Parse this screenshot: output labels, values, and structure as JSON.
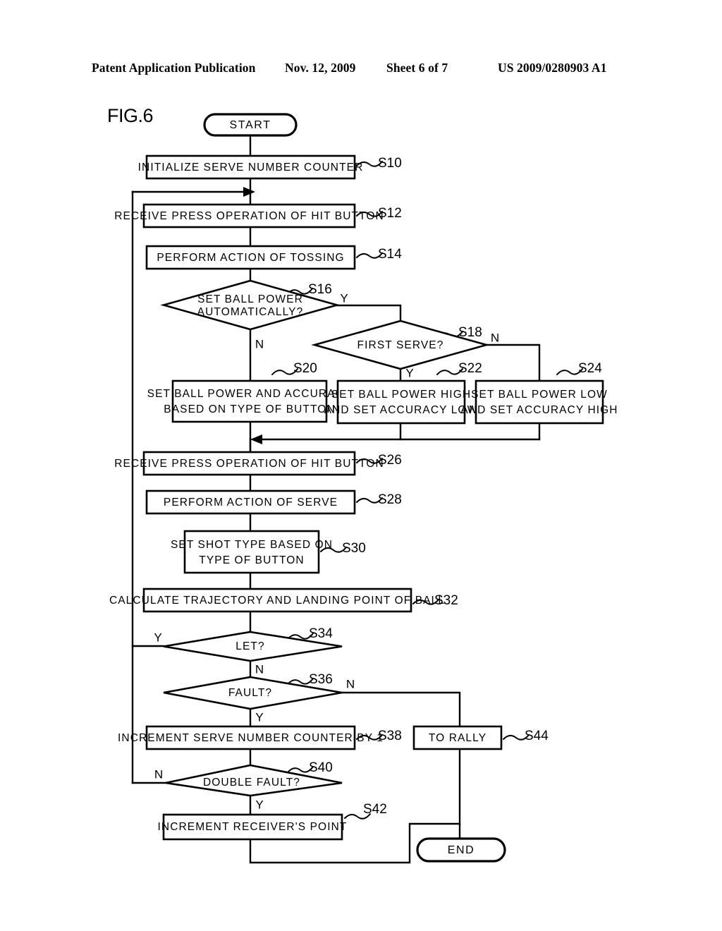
{
  "header": {
    "publication": "Patent Application Publication",
    "date": "Nov. 12, 2009",
    "sheet": "Sheet 6 of 7",
    "number": "US 2009/0280903 A1"
  },
  "figure": {
    "label": "FIG.6"
  },
  "chart_data": {
    "type": "diagram",
    "title": "FIG.6",
    "diagram_kind": "flowchart",
    "terminals": [
      {
        "id": "start",
        "label": "START"
      },
      {
        "id": "end",
        "label": "END"
      }
    ],
    "nodes": [
      {
        "step": "S10",
        "shape": "process",
        "text": "INITIALIZE SERVE NUMBER COUNTER"
      },
      {
        "step": "S12",
        "shape": "process",
        "text": "RECEIVE PRESS OPERATION OF HIT BUTTON"
      },
      {
        "step": "S14",
        "shape": "process",
        "text": "PERFORM ACTION OF TOSSING"
      },
      {
        "step": "S16",
        "shape": "decision",
        "text": "SET BALL POWER AUTOMATICALLY?"
      },
      {
        "step": "S18",
        "shape": "decision",
        "text": "FIRST SERVE?"
      },
      {
        "step": "S20",
        "shape": "process",
        "text": "SET BALL POWER AND ACCURACY BASED ON TYPE OF BUTTON"
      },
      {
        "step": "S22",
        "shape": "process",
        "text": "SET BALL POWER HIGH AND SET ACCURACY LOW"
      },
      {
        "step": "S24",
        "shape": "process",
        "text": "SET BALL POWER LOW AND SET ACCURACY HIGH"
      },
      {
        "step": "S26",
        "shape": "process",
        "text": "RECEIVE PRESS OPERATION OF HIT BUTTON"
      },
      {
        "step": "S28",
        "shape": "process",
        "text": "PERFORM ACTION OF SERVE"
      },
      {
        "step": "S30",
        "shape": "process",
        "text": "SET SHOT TYPE BASED ON TYPE OF BUTTON"
      },
      {
        "step": "S32",
        "shape": "process",
        "text": "CALCULATE TRAJECTORY AND LANDING POINT OF BALL"
      },
      {
        "step": "S34",
        "shape": "decision",
        "text": "LET?"
      },
      {
        "step": "S36",
        "shape": "decision",
        "text": "FAULT?"
      },
      {
        "step": "S38",
        "shape": "process",
        "text": "INCREMENT SERVE NUMBER COUNTER BY 1"
      },
      {
        "step": "S40",
        "shape": "decision",
        "text": "DOUBLE FAULT?"
      },
      {
        "step": "S42",
        "shape": "process",
        "text": "INCREMENT RECEIVER'S POINT"
      },
      {
        "step": "S44",
        "shape": "process",
        "text": "TO RALLY"
      }
    ],
    "branch_labels": [
      {
        "from": "S16",
        "label": "Y"
      },
      {
        "from": "S16",
        "label": "N"
      },
      {
        "from": "S18",
        "label": "Y"
      },
      {
        "from": "S18",
        "label": "N"
      },
      {
        "from": "S34",
        "label": "Y"
      },
      {
        "from": "S34",
        "label": "N"
      },
      {
        "from": "S36",
        "label": "Y"
      },
      {
        "from": "S36",
        "label": "N"
      },
      {
        "from": "S40",
        "label": "Y"
      },
      {
        "from": "S40",
        "label": "N"
      }
    ]
  },
  "nodes": {
    "start": {
      "text": "START"
    },
    "s10": {
      "text": "INITIALIZE SERVE NUMBER COUNTER",
      "step": "S10"
    },
    "s12": {
      "text": "RECEIVE PRESS OPERATION OF HIT BUTTON",
      "step": "S12"
    },
    "s14": {
      "text": "PERFORM ACTION OF TOSSING",
      "step": "S14"
    },
    "s16": {
      "line1": "SET BALL POWER",
      "line2": "AUTOMATICALLY?",
      "step": "S16"
    },
    "s18": {
      "text": "FIRST SERVE?",
      "step": "S18"
    },
    "s20": {
      "line1": "SET BALL POWER AND ACCURACY",
      "line2": "BASED ON TYPE OF BUTTON",
      "step": "S20"
    },
    "s22": {
      "line1": "SET BALL POWER HIGH",
      "line2": "AND SET ACCURACY LOW",
      "step": "S22"
    },
    "s24": {
      "line1": "SET BALL POWER LOW",
      "line2": "AND SET ACCURACY HIGH",
      "step": "S24"
    },
    "s26": {
      "text": "RECEIVE PRESS OPERATION OF HIT BUTTON",
      "step": "S26"
    },
    "s28": {
      "text": "PERFORM ACTION OF SERVE",
      "step": "S28"
    },
    "s30": {
      "line1": "SET SHOT TYPE BASED ON",
      "line2": "TYPE OF BUTTON",
      "step": "S30"
    },
    "s32": {
      "text": "CALCULATE TRAJECTORY AND LANDING POINT OF BALL",
      "step": "S32"
    },
    "s34": {
      "text": "LET?",
      "step": "S34"
    },
    "s36": {
      "text": "FAULT?",
      "step": "S36"
    },
    "s38": {
      "text": "INCREMENT SERVE NUMBER COUNTER BY 1",
      "step": "S38"
    },
    "s40": {
      "text": "DOUBLE FAULT?",
      "step": "S40"
    },
    "s42": {
      "text": "INCREMENT RECEIVER'S POINT",
      "step": "S42"
    },
    "s44": {
      "text": "TO RALLY",
      "step": "S44"
    },
    "end": {
      "text": "END"
    }
  },
  "branches": {
    "s16_y": "Y",
    "s16_n": "N",
    "s18_y": "Y",
    "s18_n": "N",
    "s34_y": "Y",
    "s34_n": "N",
    "s36_y": "Y",
    "s36_n": "N",
    "s40_y": "Y",
    "s40_n": "N"
  }
}
